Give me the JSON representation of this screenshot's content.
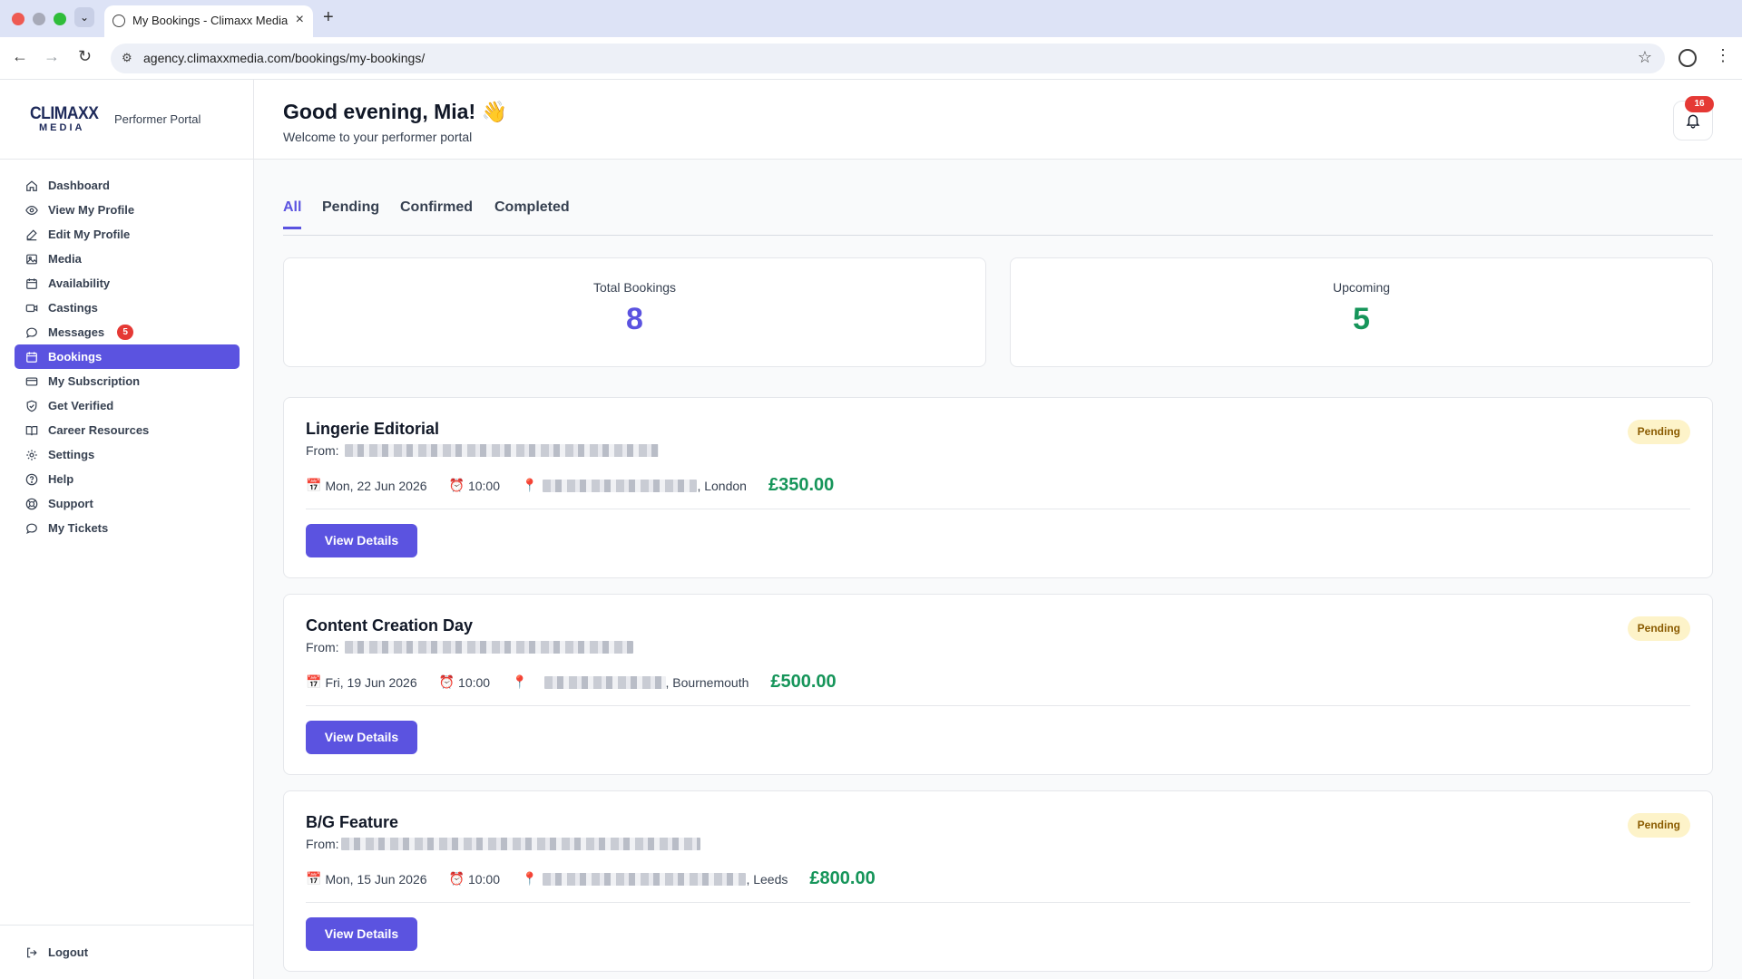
{
  "browser": {
    "tab_title": "My Bookings - Climaxx Media",
    "url": "agency.climaxxmedia.com/bookings/my-bookings/"
  },
  "brand": {
    "logo_top": "CLIMAXX",
    "logo_bottom": "MEDIA",
    "portal_label": "Performer Portal"
  },
  "sidebar": {
    "items": [
      {
        "label": "Dashboard",
        "icon": "home-icon"
      },
      {
        "label": "View My Profile",
        "icon": "eye-icon"
      },
      {
        "label": "Edit My Profile",
        "icon": "edit-icon"
      },
      {
        "label": "Media",
        "icon": "image-icon"
      },
      {
        "label": "Availability",
        "icon": "calendar-icon"
      },
      {
        "label": "Castings",
        "icon": "video-icon"
      },
      {
        "label": "Messages",
        "icon": "chat-icon",
        "badge": "5"
      },
      {
        "label": "Bookings",
        "icon": "calendar-icon",
        "active": true
      },
      {
        "label": "My Subscription",
        "icon": "credit-card-icon"
      },
      {
        "label": "Get Verified",
        "icon": "shield-check-icon"
      },
      {
        "label": "Career Resources",
        "icon": "book-icon"
      },
      {
        "label": "Settings",
        "icon": "gear-icon"
      },
      {
        "label": "Help",
        "icon": "help-icon"
      },
      {
        "label": "Support",
        "icon": "lifebuoy-icon"
      },
      {
        "label": "My Tickets",
        "icon": "chat-icon"
      }
    ],
    "logout_label": "Logout"
  },
  "header": {
    "greeting": "Good evening, Mia! 👋",
    "subtitle": "Welcome to your performer portal",
    "notification_count": "16"
  },
  "tabs": {
    "all": "All",
    "pending": "Pending",
    "confirmed": "Confirmed",
    "completed": "Completed"
  },
  "stats": {
    "total_label": "Total Bookings",
    "total_value": "8",
    "total_color": "#5b53e0",
    "upcoming_label": "Upcoming",
    "upcoming_value": "5",
    "upcoming_color": "#16955a"
  },
  "bookings": [
    {
      "title": "Lingerie Editorial",
      "from_label": "From:",
      "status": "Pending",
      "date": "Mon, 22 Jun 2026",
      "time": "10:00",
      "location_city": ", London",
      "price": "£350.00",
      "button": "View Details"
    },
    {
      "title": "Content Creation Day",
      "from_label": "From:",
      "status": "Pending",
      "date": "Fri, 19 Jun 2026",
      "time": "10:00",
      "location_city": ", Bournemouth",
      "price": "£500.00",
      "button": "View Details"
    },
    {
      "title": "B/G Feature",
      "from_label": "From:",
      "status": "Pending",
      "date": "Mon, 15 Jun 2026",
      "time": "10:00",
      "location_city": ", Leeds",
      "price": "£800.00",
      "button": "View Details"
    }
  ]
}
